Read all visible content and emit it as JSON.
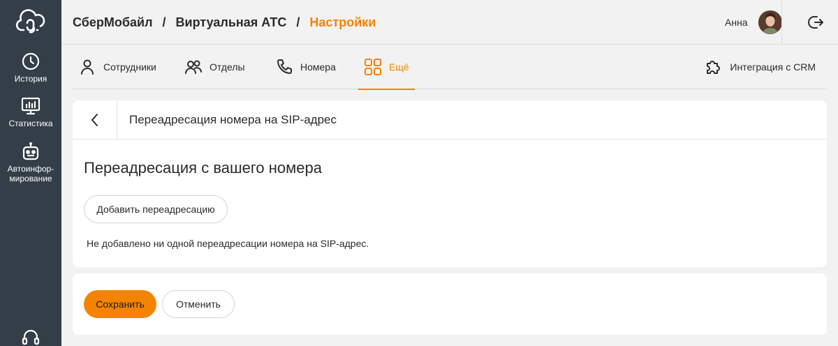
{
  "sidebar": {
    "items": [
      {
        "label": "История",
        "icon": "clock-icon"
      },
      {
        "label": "Статистика",
        "icon": "monitor-chart-icon"
      },
      {
        "label": "Автоинфор-мирование",
        "icon": "robot-icon"
      }
    ],
    "support_icon": "headset-icon",
    "background": "#333e48"
  },
  "header": {
    "breadcrumb": [
      "СберМобайл",
      "Виртуальная АТС",
      "Настройки"
    ],
    "separator": "/",
    "user_name": "Анна",
    "accent": "#f48300"
  },
  "tabs": [
    {
      "label": "Сотрудники",
      "icon": "person-icon"
    },
    {
      "label": "Отделы",
      "icon": "people-icon"
    },
    {
      "label": "Номера",
      "icon": "phone-icon"
    },
    {
      "label": "Ещё",
      "icon": "grid-icon",
      "active": true
    },
    {
      "label": "Интеграция с CRM",
      "icon": "puzzle-icon"
    }
  ],
  "page": {
    "header_title": "Переадресация номера на SIP-адрес",
    "section_title": "Переадресация с вашего номера",
    "add_button": "Добавить переадресацию",
    "empty_text": "Не добавлено ни одной переадресации номера на SIP-адрес."
  },
  "actions": {
    "save": "Сохранить",
    "cancel": "Отменить"
  }
}
